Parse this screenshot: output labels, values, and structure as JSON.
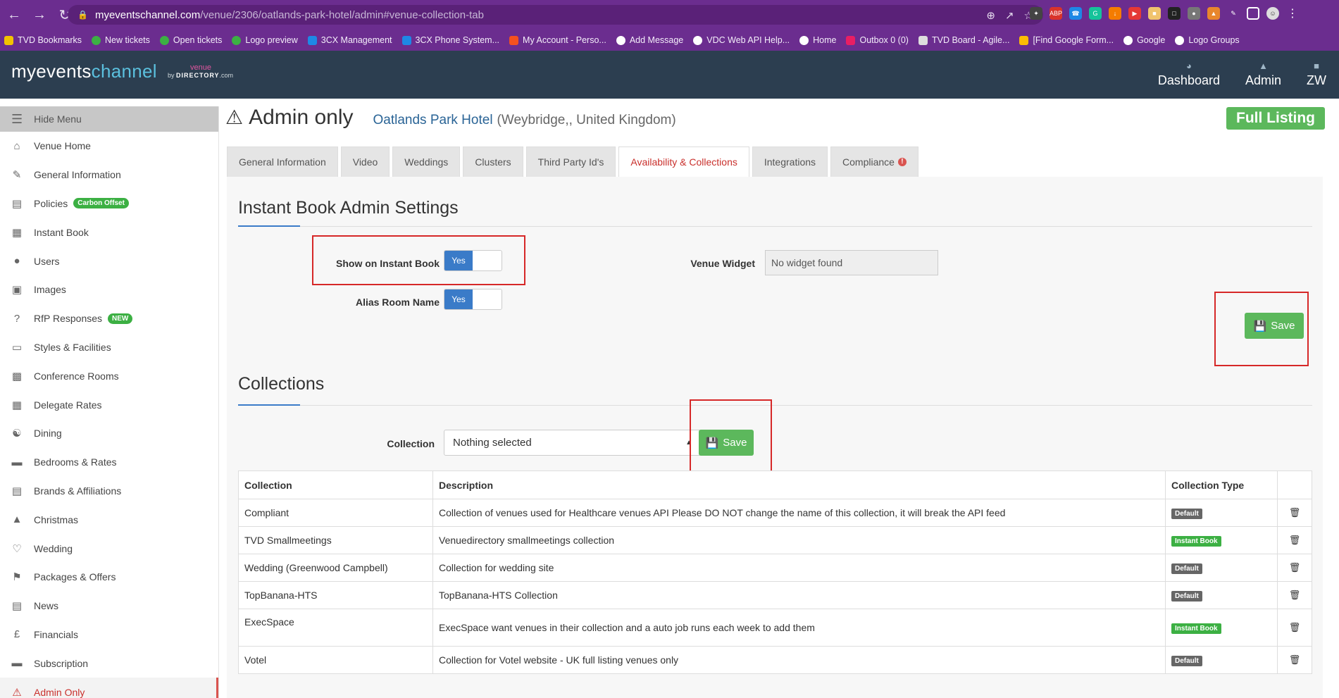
{
  "browser": {
    "url_host": "myeventschannel.com",
    "url_path": "/venue/2306/oatlands-park-hotel/admin#venue-collection-tab",
    "bookmarks": [
      "TVD Bookmarks",
      "New tickets",
      "Open tickets",
      "Logo preview",
      "3CX Management",
      "3CX Phone System...",
      "My Account - Perso...",
      "Add Message",
      "VDC Web API Help...",
      "Home",
      "Outbox 0 (0)",
      "TVD Board - Agile...",
      "[Find Google Form...",
      "Google",
      "Logo Groups"
    ],
    "ext_abp": "ABP"
  },
  "header": {
    "brand_a": "myevents",
    "brand_b": "channel",
    "brand_by": "by",
    "brand_venue": "venue",
    "brand_dir": "DIRECTORY",
    "brand_com": ".com",
    "nav": {
      "dashboard": "Dashboard",
      "admin": "Admin",
      "user": "ZW"
    }
  },
  "sidebar": {
    "hide_menu": "Hide Menu",
    "items": [
      {
        "label": "Venue Home"
      },
      {
        "label": "General Information"
      },
      {
        "label": "Policies",
        "badge": "Carbon Offset"
      },
      {
        "label": "Instant Book"
      },
      {
        "label": "Users"
      },
      {
        "label": "Images"
      },
      {
        "label": "RfP Responses",
        "badge": "NEW"
      },
      {
        "label": "Styles & Facilities"
      },
      {
        "label": "Conference Rooms"
      },
      {
        "label": "Delegate Rates"
      },
      {
        "label": "Dining"
      },
      {
        "label": "Bedrooms & Rates"
      },
      {
        "label": "Brands & Affiliations"
      },
      {
        "label": "Christmas"
      },
      {
        "label": "Wedding"
      },
      {
        "label": "Packages & Offers"
      },
      {
        "label": "News"
      },
      {
        "label": "Financials"
      },
      {
        "label": "Subscription"
      },
      {
        "label": "Admin Only"
      }
    ]
  },
  "page": {
    "title": "Admin only",
    "venue_name": "Oatlands Park Hotel",
    "venue_location": "(Weybridge,, United Kingdom)",
    "full_listing": "Full Listing"
  },
  "tabs": [
    "General Information",
    "Video",
    "Weddings",
    "Clusters",
    "Third Party Id's",
    "Availability & Collections",
    "Integrations",
    "Compliance"
  ],
  "instant_book": {
    "title": "Instant Book Admin Settings",
    "show_label": "Show on Instant Book",
    "show_value": "Yes",
    "alias_label": "Alias Room Name",
    "alias_value": "Yes",
    "widget_label": "Venue Widget",
    "widget_value": "No widget found",
    "save": "Save"
  },
  "collections": {
    "title": "Collections",
    "select_label": "Collection",
    "select_value": "Nothing selected",
    "save": "Save",
    "headers": [
      "Collection",
      "Description",
      "Collection Type",
      ""
    ],
    "rows": [
      {
        "name": "Compliant",
        "desc": "Collection of venues used for Healthcare venues API Please DO NOT change the name of this collection, it will break the API feed",
        "type": "Default"
      },
      {
        "name": "TVD Smallmeetings",
        "desc": "Venuedirectory smallmeetings collection",
        "type": "Instant Book"
      },
      {
        "name": "Wedding (Greenwood Campbell)",
        "desc": "Collection for wedding site",
        "type": "Default"
      },
      {
        "name": "TopBanana-HTS",
        "desc": "TopBanana-HTS Collection",
        "type": "Default"
      },
      {
        "name": "ExecSpace",
        "desc": "ExecSpace want venues in their collection and a auto job runs each week to add them",
        "type": "Instant Book"
      },
      {
        "name": "Votel",
        "desc": "Collection for Votel website - UK full listing venues only",
        "type": "Default"
      }
    ]
  },
  "colors": {
    "browser_bg": "#6b2d8f",
    "header_bg": "#2c3e50",
    "accent_blue": "#3a7bc8",
    "save_green": "#5cb85c",
    "highlight_red": "#d62828"
  }
}
